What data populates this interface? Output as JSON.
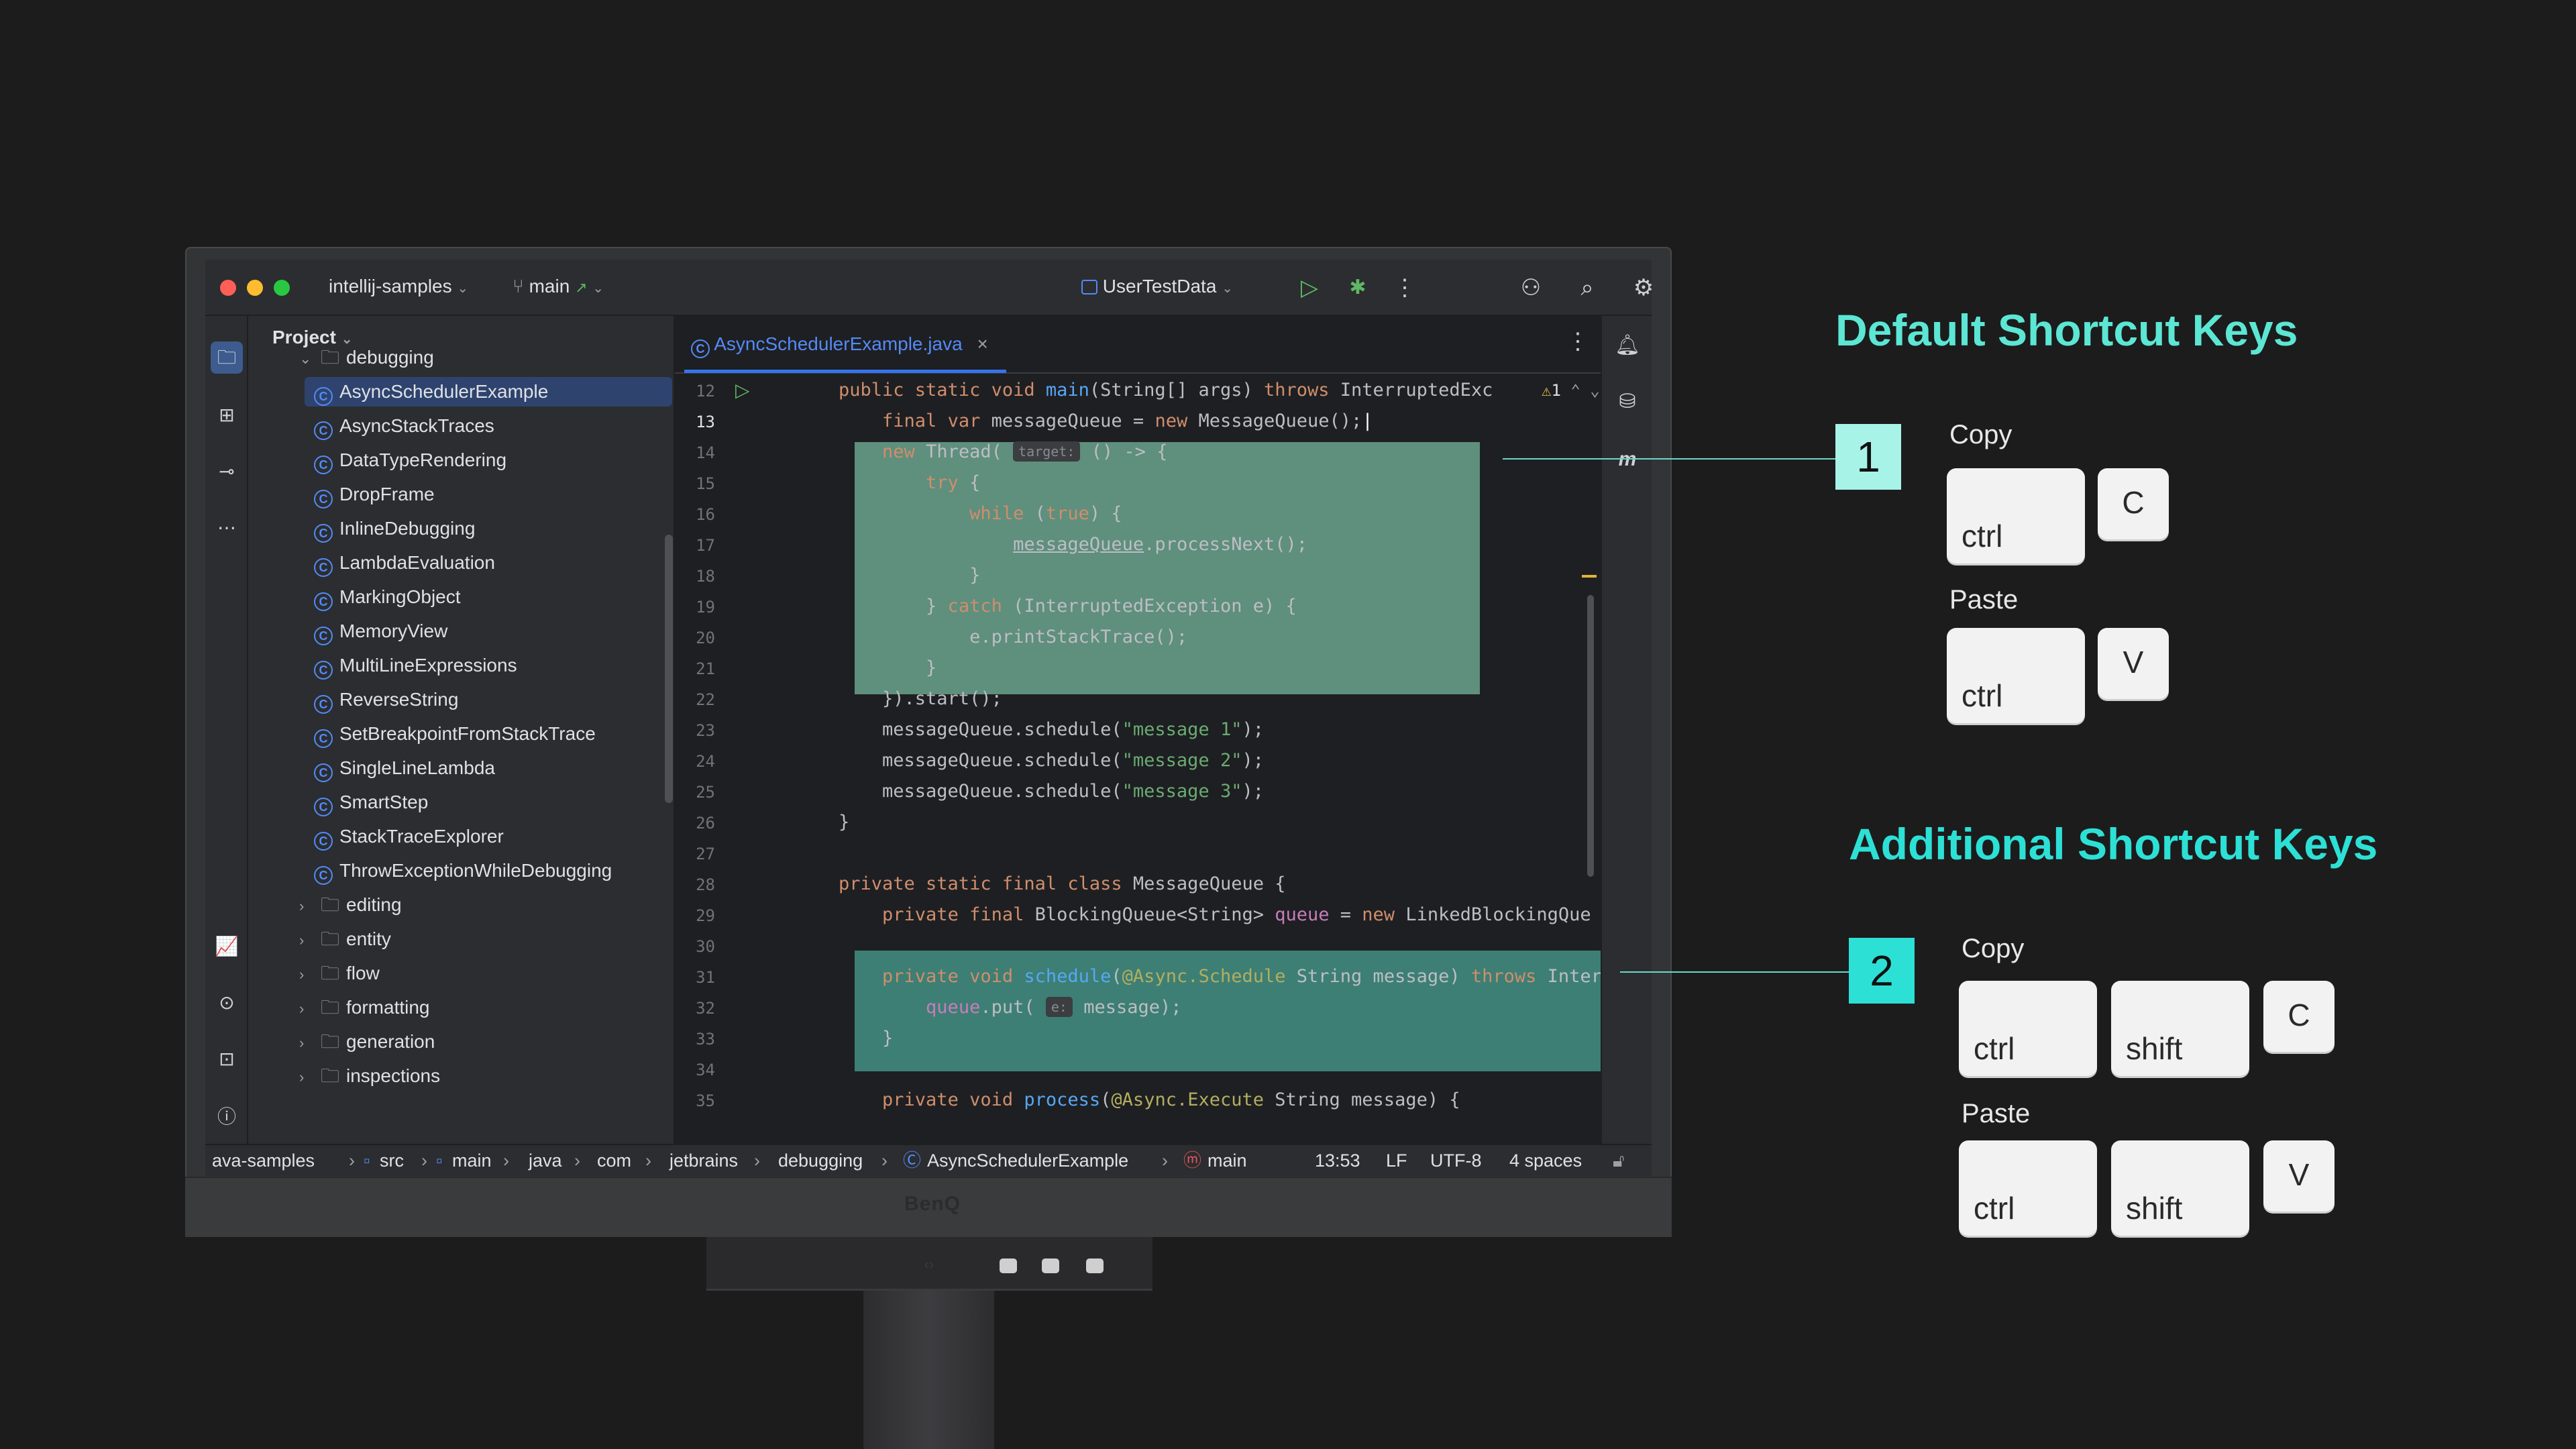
{
  "ide": {
    "project_name": "intellij-samples",
    "branch": "main",
    "run_config": "UserTestData",
    "panel_title": "Project",
    "tab_title": "AsyncSchedulerExample.java",
    "warning_count": "1",
    "tree": [
      {
        "label": "debugging",
        "type": "folder",
        "expanded": true
      },
      {
        "label": "AsyncSchedulerExample",
        "type": "class",
        "selected": true
      },
      {
        "label": "AsyncStackTraces",
        "type": "class"
      },
      {
        "label": "DataTypeRendering",
        "type": "class"
      },
      {
        "label": "DropFrame",
        "type": "class"
      },
      {
        "label": "InlineDebugging",
        "type": "class"
      },
      {
        "label": "LambdaEvaluation",
        "type": "class"
      },
      {
        "label": "MarkingObject",
        "type": "class"
      },
      {
        "label": "MemoryView",
        "type": "class"
      },
      {
        "label": "MultiLineExpressions",
        "type": "class"
      },
      {
        "label": "ReverseString",
        "type": "class"
      },
      {
        "label": "SetBreakpointFromStackTrace",
        "type": "class"
      },
      {
        "label": "SingleLineLambda",
        "type": "class"
      },
      {
        "label": "SmartStep",
        "type": "class"
      },
      {
        "label": "StackTraceExplorer",
        "type": "class"
      },
      {
        "label": "ThrowExceptionWhileDebugging",
        "type": "class"
      },
      {
        "label": "editing",
        "type": "folder"
      },
      {
        "label": "entity",
        "type": "folder"
      },
      {
        "label": "flow",
        "type": "folder"
      },
      {
        "label": "formatting",
        "type": "folder"
      },
      {
        "label": "generation",
        "type": "folder"
      },
      {
        "label": "inspections",
        "type": "folder"
      }
    ],
    "line_numbers": [
      "12",
      "13",
      "14",
      "15",
      "16",
      "17",
      "18",
      "19",
      "20",
      "21",
      "22",
      "23",
      "24",
      "25",
      "26",
      "27",
      "28",
      "29",
      "30",
      "31",
      "32",
      "33",
      "34",
      "35"
    ],
    "hints": {
      "target": "target:",
      "e": "e:"
    },
    "status": {
      "crumbs": [
        "ava-samples",
        "src",
        "main",
        "java",
        "com",
        "jetbrains",
        "debugging",
        "AsyncSchedulerExample",
        "main"
      ],
      "position": "13:53",
      "line_sep": "LF",
      "encoding": "UTF-8",
      "indent": "4 spaces"
    }
  },
  "monitor": {
    "brand": "BenQ"
  },
  "panel": {
    "default": {
      "heading": "Default Shortcut Keys",
      "badge": "1",
      "copy_label": "Copy",
      "paste_label": "Paste",
      "copy_keys": [
        "ctrl",
        "C"
      ],
      "paste_keys": [
        "ctrl",
        "V"
      ]
    },
    "additional": {
      "heading": "Additional Shortcut Keys",
      "badge": "2",
      "copy_label": "Copy",
      "paste_label": "Paste",
      "copy_keys": [
        "ctrl",
        "shift",
        "C"
      ],
      "paste_keys": [
        "ctrl",
        "shift",
        "V"
      ]
    },
    "colors": {
      "accent": "#5ce6d4",
      "badge1": "#a8f3e8",
      "badge2": "#2de0d6"
    }
  }
}
